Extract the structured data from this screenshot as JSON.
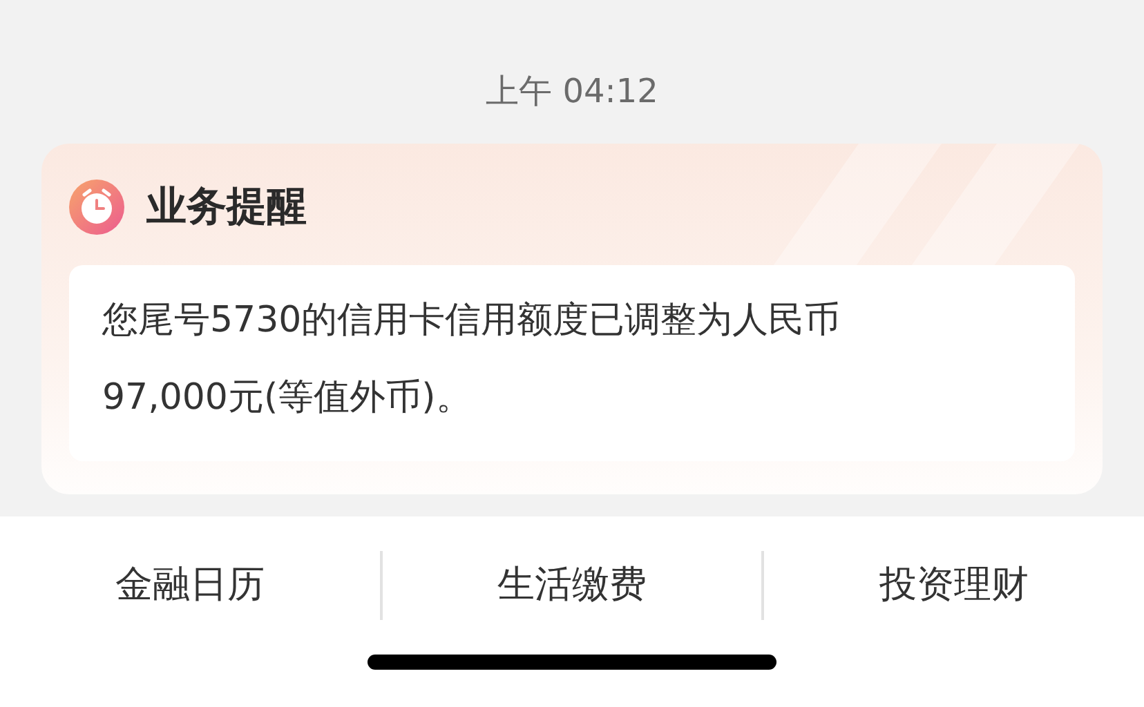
{
  "timestamp": "上午 04:12",
  "card": {
    "title": "业务提醒",
    "message": "您尾号5730的信用卡信用额度已调整为人民币97,000元(等值外币)。"
  },
  "menu": [
    {
      "label": "金融日历"
    },
    {
      "label": "生活缴费"
    },
    {
      "label": "投资理财"
    }
  ]
}
